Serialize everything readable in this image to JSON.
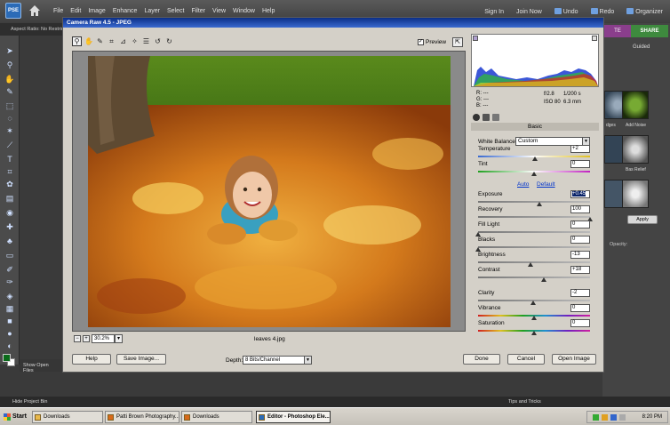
{
  "app": {
    "logo": "PSE",
    "menu": [
      "File",
      "Edit",
      "Image",
      "Enhance",
      "Layer",
      "Select",
      "Filter",
      "View",
      "Window",
      "Help"
    ],
    "sign_in": "Sign In",
    "join_now": "Join Now",
    "undo": "Undo",
    "redo": "Redo",
    "organizer": "Organizer"
  },
  "options_bar": {
    "aspect_ratio_label": "Aspect Ratio:",
    "aspect_ratio_value": "No Restric"
  },
  "right_panel": {
    "create_tab": "TE",
    "share_tab": "SHARE",
    "guided": "Guided",
    "effects": [
      "dges",
      "Add Noise",
      "Bas Relief"
    ],
    "apply": "Apply",
    "opacity_label": "Opacity:"
  },
  "show_open_files": "Show Open Files",
  "hide_project_bin": "Hide Project Bin",
  "tips_and_tricks": "Tips and Tricks",
  "dialog": {
    "title": "Camera Raw 4.5  -  JPEG",
    "preview_label": "Preview",
    "preview_checked": true,
    "zoom_value": "30.2%",
    "filename": "leaves 4.jpg",
    "readout": {
      "r": "R:  ---",
      "g": "G:  ---",
      "b": "B:  ---",
      "aperture": "f/2.8",
      "shutter": "1/200 s",
      "iso": "ISO 80",
      "focal": "6.3 mm"
    },
    "section": "Basic",
    "white_balance_label": "White Balance:",
    "white_balance_value": "Custom",
    "auto_label": "Auto",
    "default_label": "Default",
    "sliders": [
      {
        "label": "Temperature",
        "value": "+2",
        "pos": 0.51,
        "track": "temp"
      },
      {
        "label": "Tint",
        "value": "0",
        "pos": 0.5,
        "track": "tint"
      },
      {
        "label": "Exposure",
        "value": "+0.45",
        "pos": 0.55,
        "track": "gray",
        "selected": true
      },
      {
        "label": "Recovery",
        "value": "100",
        "pos": 1.0,
        "track": "gray"
      },
      {
        "label": "Fill Light",
        "value": "0",
        "pos": 0.0,
        "track": "gray"
      },
      {
        "label": "Blacks",
        "value": "0",
        "pos": 0.0,
        "track": "gray"
      },
      {
        "label": "Brightness",
        "value": "-13",
        "pos": 0.47,
        "track": "gray"
      },
      {
        "label": "Contrast",
        "value": "+18",
        "pos": 0.59,
        "track": "gray"
      },
      {
        "label": "Clarity",
        "value": "-2",
        "pos": 0.49,
        "track": "gray"
      },
      {
        "label": "Vibrance",
        "value": "0",
        "pos": 0.5,
        "track": "rainbow"
      },
      {
        "label": "Saturation",
        "value": "0",
        "pos": 0.5,
        "track": "rainbow"
      }
    ],
    "help": "Help",
    "save_image": "Save Image...",
    "depth_label": "Depth:",
    "depth_value": "8 Bits/Channel",
    "done": "Done",
    "cancel": "Cancel",
    "open_image": "Open Image"
  },
  "taskbar": {
    "start": "Start",
    "tasks": [
      "Downloads",
      "Patti Brown Photography...",
      "Downloads",
      "Editor - Photoshop Ele..."
    ],
    "clock": "8:20 PM"
  }
}
